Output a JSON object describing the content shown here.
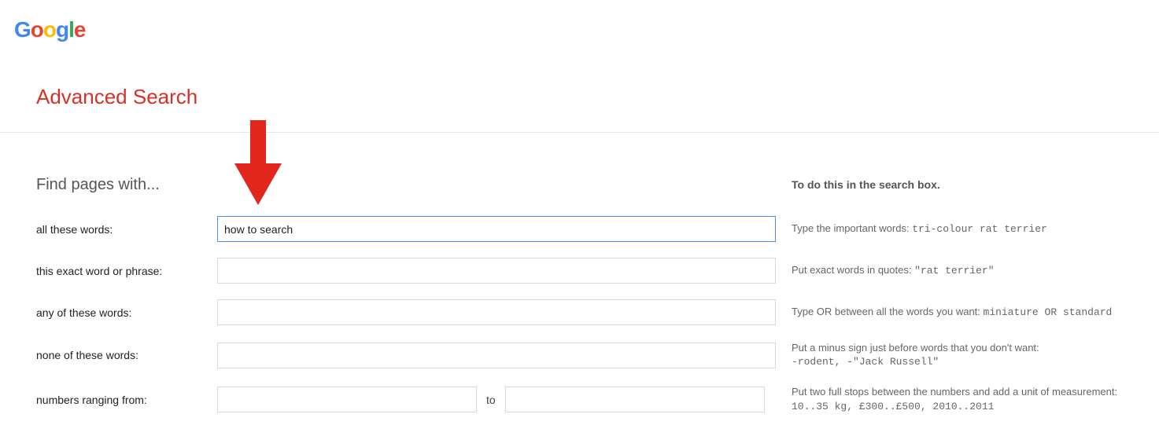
{
  "logo": {
    "g1": "G",
    "o1": "o",
    "o2": "o",
    "g2": "g",
    "l": "l",
    "e": "e"
  },
  "title": "Advanced Search",
  "headers": {
    "left": "Find pages with...",
    "right": "To do this in the search box."
  },
  "rows": {
    "all_words": {
      "label": "all these words:",
      "value": "how to search",
      "hint_text": "Type the important words: ",
      "hint_code": "tri-colour rat terrier"
    },
    "exact_phrase": {
      "label": "this exact word or phrase:",
      "value": "",
      "hint_text": "Put exact words in quotes: ",
      "hint_code": "\"rat terrier\""
    },
    "any_words": {
      "label": "any of these words:",
      "value": "",
      "hint_text": "Type OR between all the words you want: ",
      "hint_code": "miniature OR standard"
    },
    "none_words": {
      "label": "none of these words:",
      "value": "",
      "hint_text": "Put a minus sign just before words that you don't want:",
      "hint_code": "-rodent, -\"Jack Russell\""
    },
    "range": {
      "label": "numbers ranging from:",
      "from": "",
      "to": "",
      "sep": "to",
      "hint_text": "Put two full stops between the numbers and add a unit of measurement:",
      "hint_code": "10..35 kg, £300..£500, 2010..2011"
    }
  }
}
